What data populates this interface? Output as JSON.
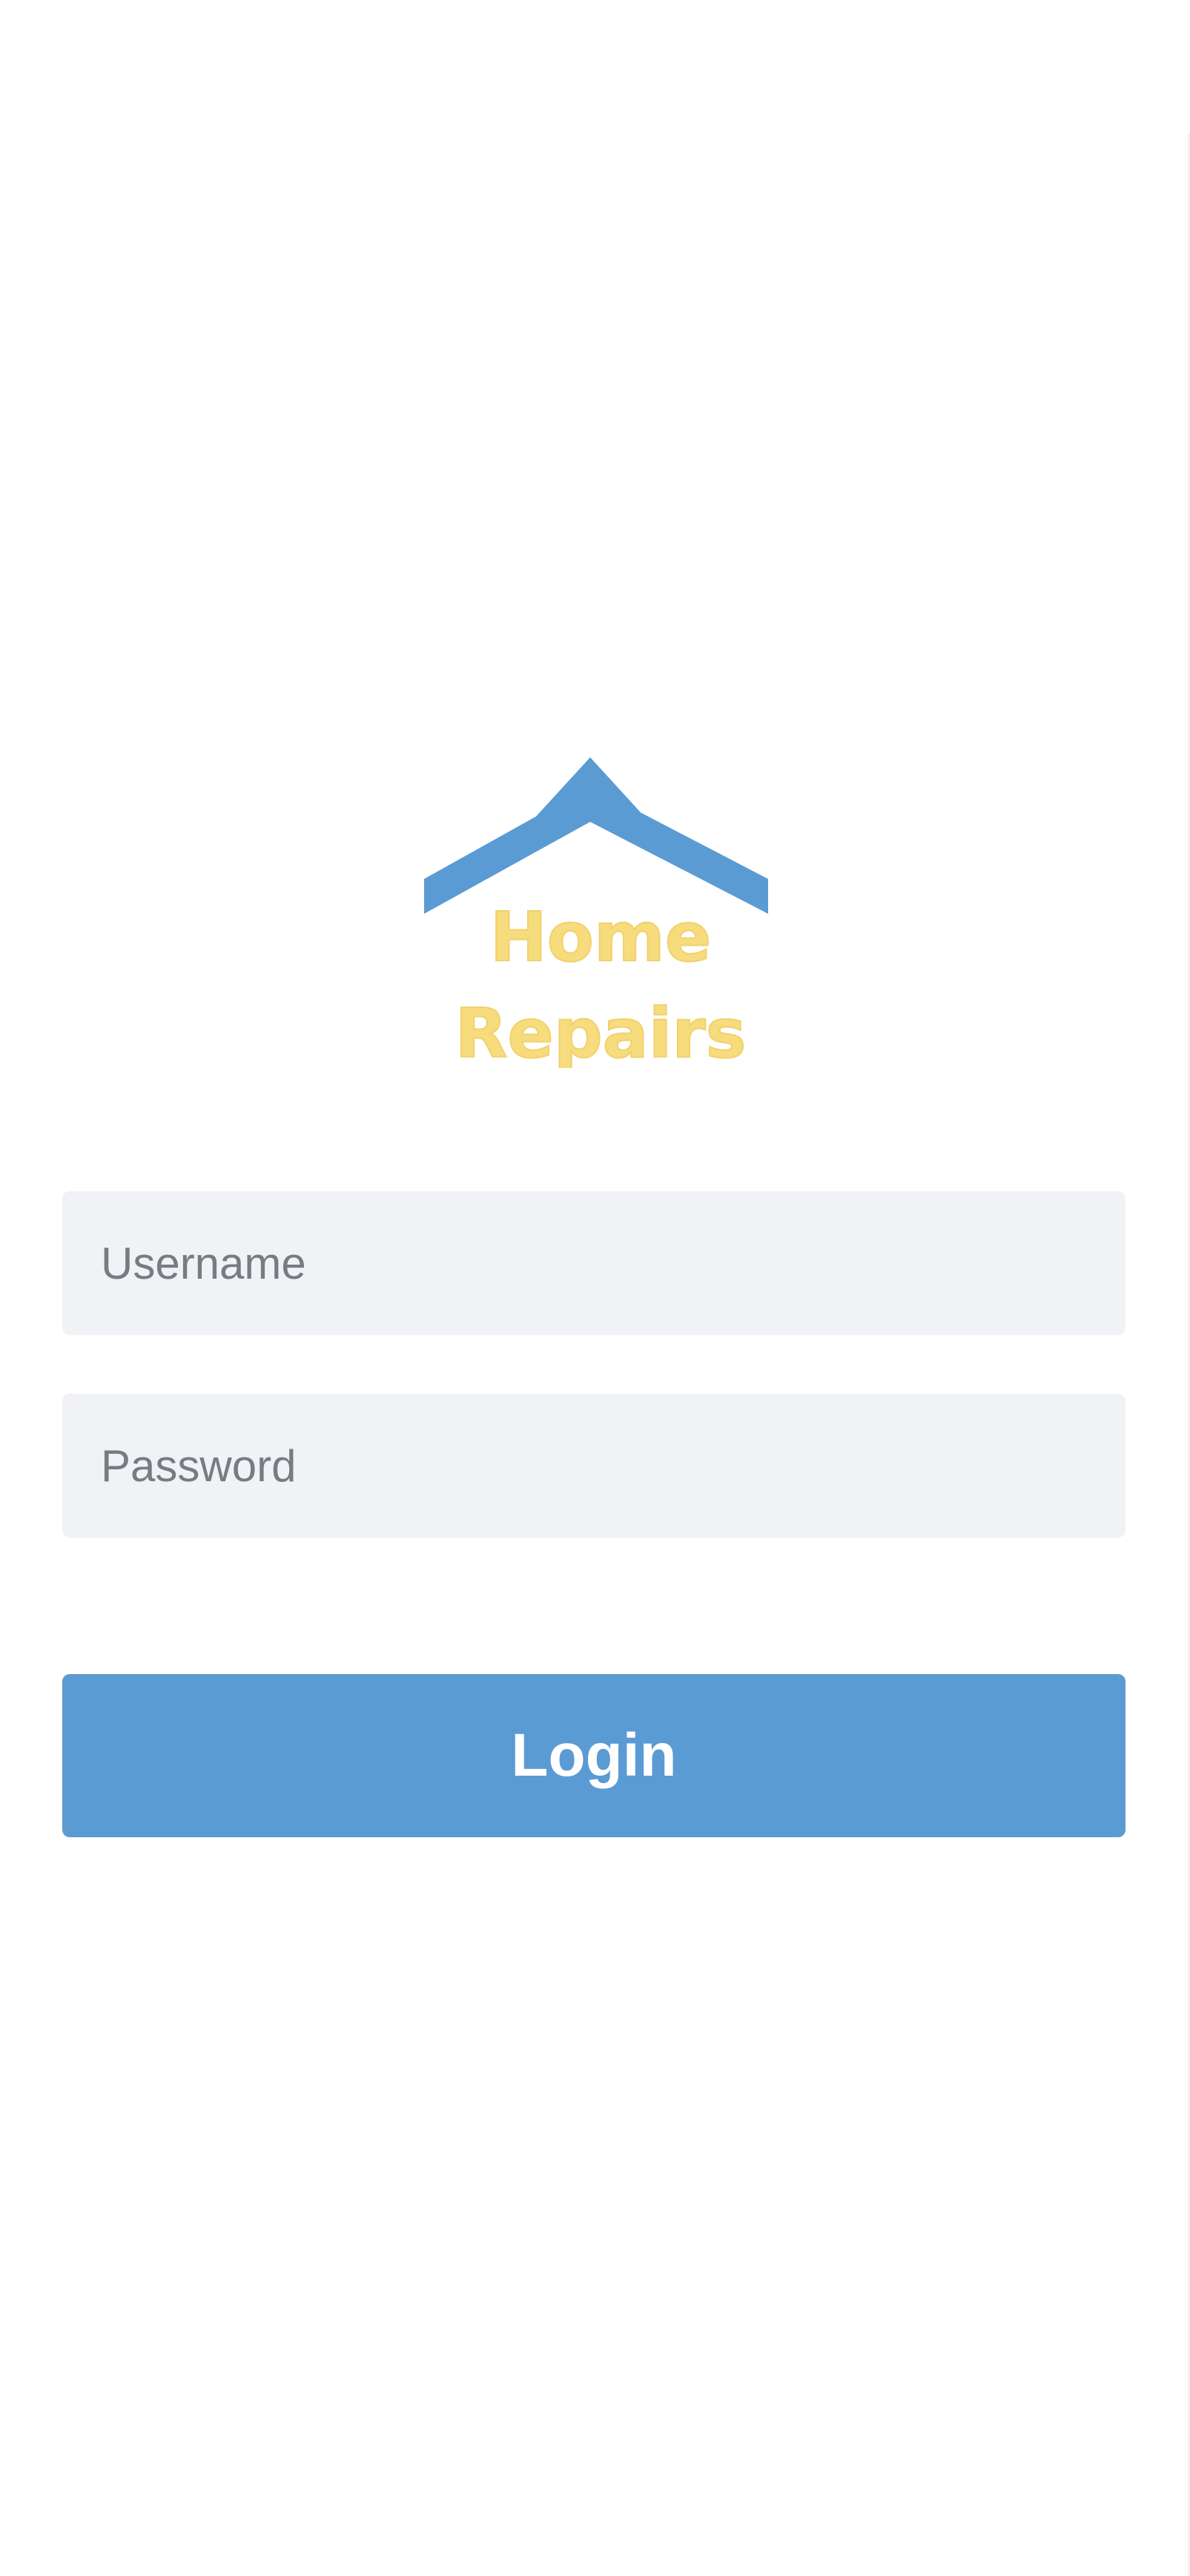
{
  "logo": {
    "line1": "Home",
    "line2": "Repairs",
    "roof_color": "#5b9bd4",
    "text_color": "#f6dc7d"
  },
  "form": {
    "username_placeholder": "Username",
    "password_placeholder": "Password",
    "login_label": "Login"
  },
  "colors": {
    "background": "#ffffff",
    "input_background": "#f1f2f6",
    "button_background": "#5b9bd4",
    "button_text": "#ffffff"
  }
}
